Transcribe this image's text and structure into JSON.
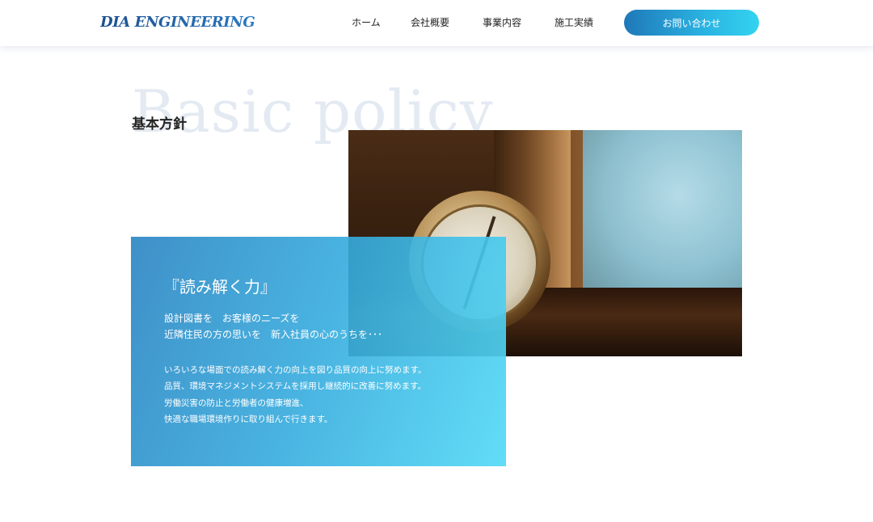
{
  "header": {
    "logo": "DIA ENGINEERING",
    "nav": [
      "ホーム",
      "会社概要",
      "事業内容",
      "施工実績"
    ],
    "contact_button": "お問い合わせ"
  },
  "section": {
    "bg_heading": "Basic policy",
    "title": "基本方針"
  },
  "policy": {
    "heading": "『読み解く力』",
    "lead": [
      "設計図書を　お客様のニーズを",
      "近隣住民の方の思いを　新入社員の心のうちを･･･"
    ],
    "body": [
      "いろいろな場面での読み解く力の向上を図り品質の向上に努めます。",
      "品質、環境マネジメントシステムを採用し継続的に改善に努めます。",
      "労働災害の防止と労働者の健康増進、",
      "快適な職場環境作りに取り組んで行きます。"
    ]
  }
}
